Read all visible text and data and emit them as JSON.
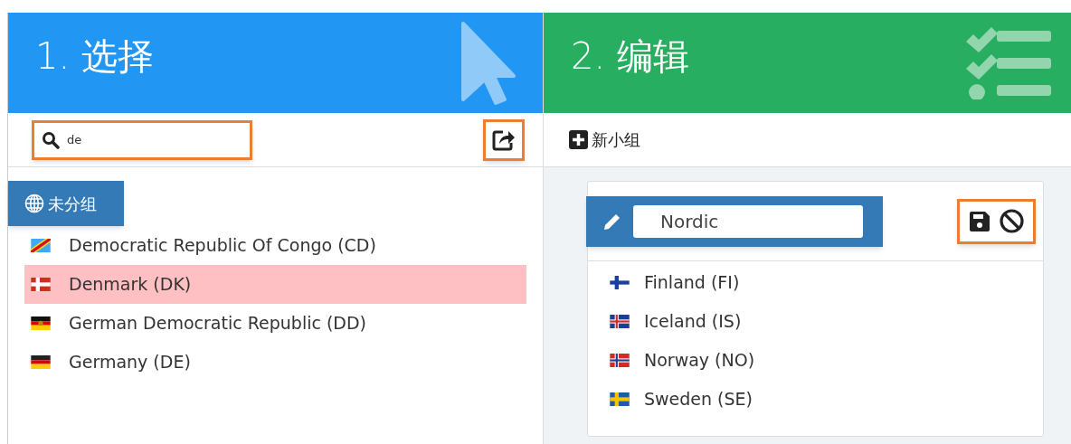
{
  "select_panel": {
    "title": "1. 选择",
    "search": {
      "value": "de"
    },
    "group": {
      "label": "未分组"
    },
    "countries": [
      {
        "name": "Democratic Republic Of Congo (CD)",
        "kind": "cd",
        "selected": false
      },
      {
        "name": "Denmark (DK)",
        "kind": "dk",
        "selected": true
      },
      {
        "name": "German Democratic Republic (DD)",
        "kind": "dd",
        "selected": false
      },
      {
        "name": "Germany (DE)",
        "kind": "de",
        "selected": false
      }
    ]
  },
  "edit_panel": {
    "title": "2. 编辑",
    "new_group_label": "新小组",
    "group_name": {
      "value": "Nordic"
    },
    "countries": [
      {
        "name": "Finland (FI)",
        "kind": "fi"
      },
      {
        "name": "Iceland (IS)",
        "kind": "is"
      },
      {
        "name": "Norway (NO)",
        "kind": "no"
      },
      {
        "name": "Sweden (SE)",
        "kind": "se"
      }
    ]
  }
}
